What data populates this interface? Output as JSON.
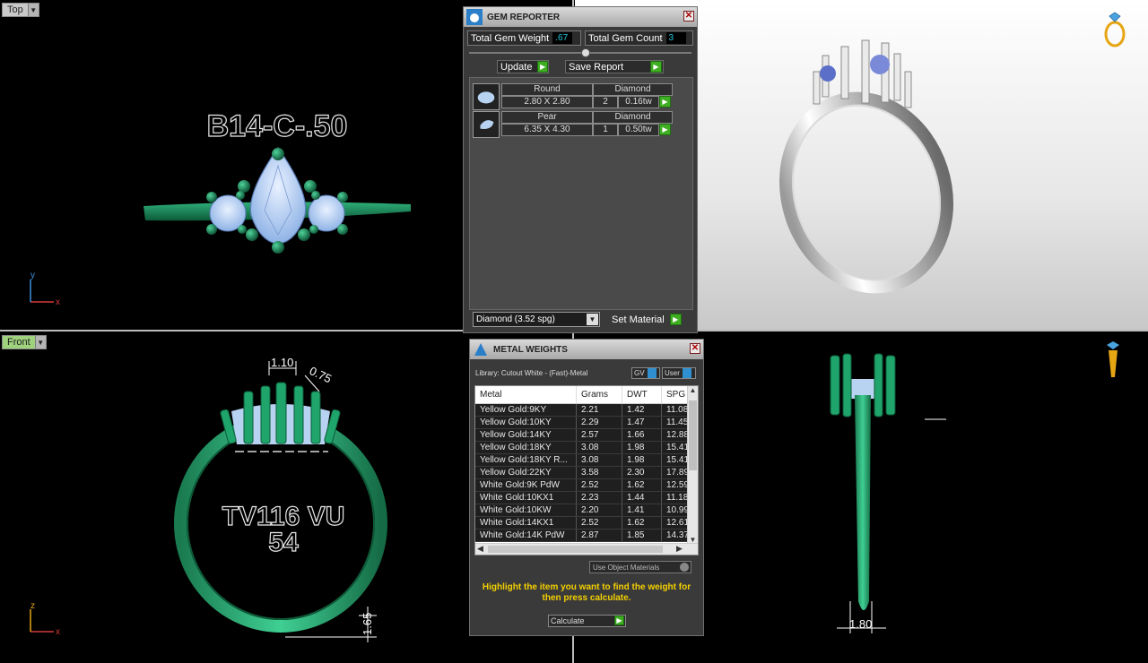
{
  "viewports": {
    "top": {
      "label": "Top",
      "ring_text": "B14-C-.50",
      "axis_v": "y",
      "axis_h": "x"
    },
    "front": {
      "label": "Front",
      "ring_text_line1": "TV116 VU",
      "ring_text_line2": "54",
      "dim_1": "1.10",
      "dim_2": "0.75",
      "dim_3": "1.65",
      "axis_v": "z",
      "axis_h": "x"
    },
    "right": {
      "dim": "1.80"
    },
    "colors": {
      "model_green": "#1e8a5c",
      "gem_blue": "#b8d2f2",
      "active_tab": "#9fd27d"
    }
  },
  "gem_reporter": {
    "title": "GEM REPORTER",
    "total_weight_label": "Total Gem Weight",
    "total_weight_value": ".67",
    "total_count_label": "Total Gem Count",
    "total_count_value": "3",
    "update_label": "Update",
    "save_report_label": "Save Report",
    "gems": [
      {
        "shape": "Round",
        "material": "Diamond",
        "size": "2.80 X 2.80",
        "count": "2",
        "weight": "0.16tw"
      },
      {
        "shape": "Pear",
        "material": "Diamond",
        "size": "6.35 X 4.30",
        "count": "1",
        "weight": "0.50tw"
      }
    ],
    "material_select": "Diamond    (3.52 spg)",
    "set_material_label": "Set Material"
  },
  "metal_weights": {
    "title": "METAL WEIGHTS",
    "library": "Library: Cutout White - (Fast)-Metal",
    "gv_label": "GV",
    "user_label": "User",
    "columns": [
      "Metal",
      "Grams",
      "DWT",
      "SPG"
    ],
    "rows": [
      [
        "Yellow Gold:9KY",
        "2.21",
        "1.42",
        "11.08"
      ],
      [
        "Yellow Gold:10KY",
        "2.29",
        "1.47",
        "11.45"
      ],
      [
        "Yellow Gold:14KY",
        "2.57",
        "1.66",
        "12.88"
      ],
      [
        "Yellow Gold:18KY",
        "3.08",
        "1.98",
        "15.41"
      ],
      [
        "Yellow Gold:18KY R...",
        "3.08",
        "1.98",
        "15.41"
      ],
      [
        "Yellow Gold:22KY",
        "3.58",
        "2.30",
        "17.89"
      ],
      [
        "White Gold:9K PdW",
        "2.52",
        "1.62",
        "12.59"
      ],
      [
        "White Gold:10KX1",
        "2.23",
        "1.44",
        "11.18"
      ],
      [
        "White Gold:10KW",
        "2.20",
        "1.41",
        "10.99"
      ],
      [
        "White Gold:14KX1",
        "2.52",
        "1.62",
        "12.61"
      ],
      [
        "White Gold:14K PdW",
        "2.87",
        "1.85",
        "14.37"
      ]
    ],
    "use_object_materials": "Use Object Materials",
    "hint": "Highlight the item you want to find the weight for then press calculate.",
    "calculate_label": "Calculate"
  }
}
